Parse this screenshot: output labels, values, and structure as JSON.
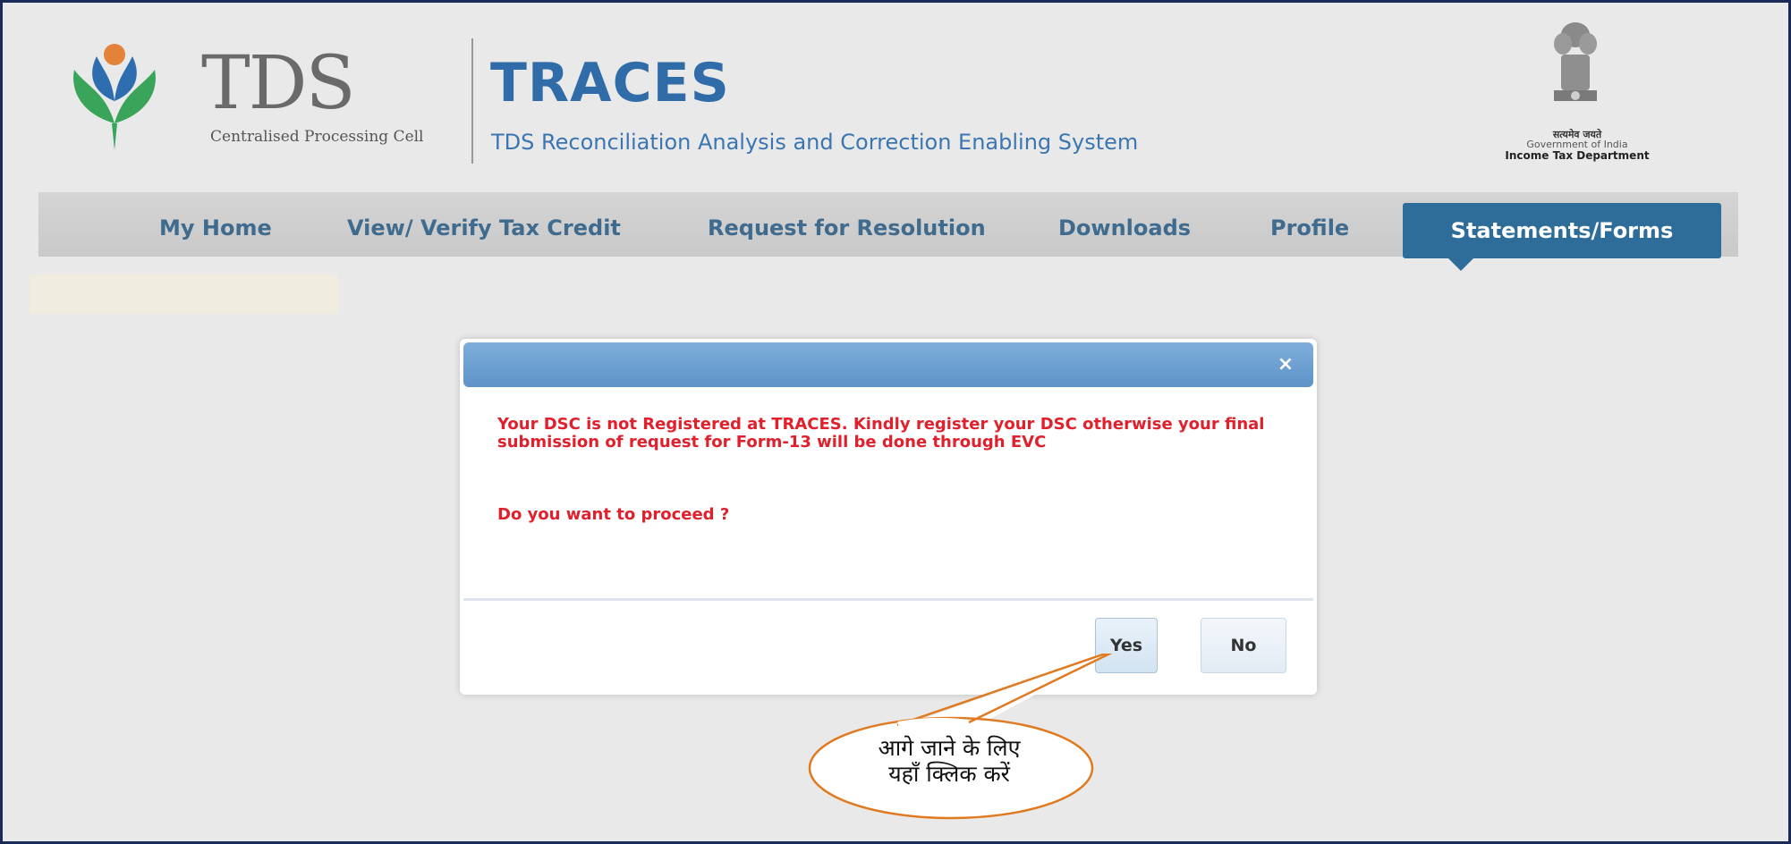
{
  "header": {
    "logo_word": "TDS",
    "logo_caption": "Centralised Processing Cell",
    "app_title": "TRACES",
    "app_subtitle": "TDS Reconciliation Analysis and Correction Enabling System",
    "emblem_line1": "सत्यमेव जयते",
    "emblem_line2": "Government of India",
    "emblem_line3": "Income Tax Department"
  },
  "nav": {
    "items": [
      {
        "label": "My Home"
      },
      {
        "label": "View/ Verify Tax Credit"
      },
      {
        "label": "Request for Resolution"
      },
      {
        "label": "Downloads"
      },
      {
        "label": "Profile"
      }
    ],
    "active": {
      "label": "Statements/Forms"
    }
  },
  "dialog": {
    "close_glyph": "×",
    "message": "Your DSC is not Registered at TRACES. Kindly register your DSC otherwise your final submission of request for Form-13 will be done through EVC",
    "question": "Do you want to proceed ?",
    "yes_label": "Yes",
    "no_label": "No"
  },
  "callout": {
    "line1": "आगे जाने के लिए",
    "line2": "यहाँ क्लिक करें"
  },
  "colors": {
    "frame_border": "#1a2a57",
    "nav_active_bg": "#2e6d9a",
    "nav_text": "#3f6b8e",
    "message_red": "#e0202c",
    "titlebar_blue": "#6a9fd1",
    "callout_stroke": "#e07a20",
    "traces_blue": "#2f6ca8"
  }
}
